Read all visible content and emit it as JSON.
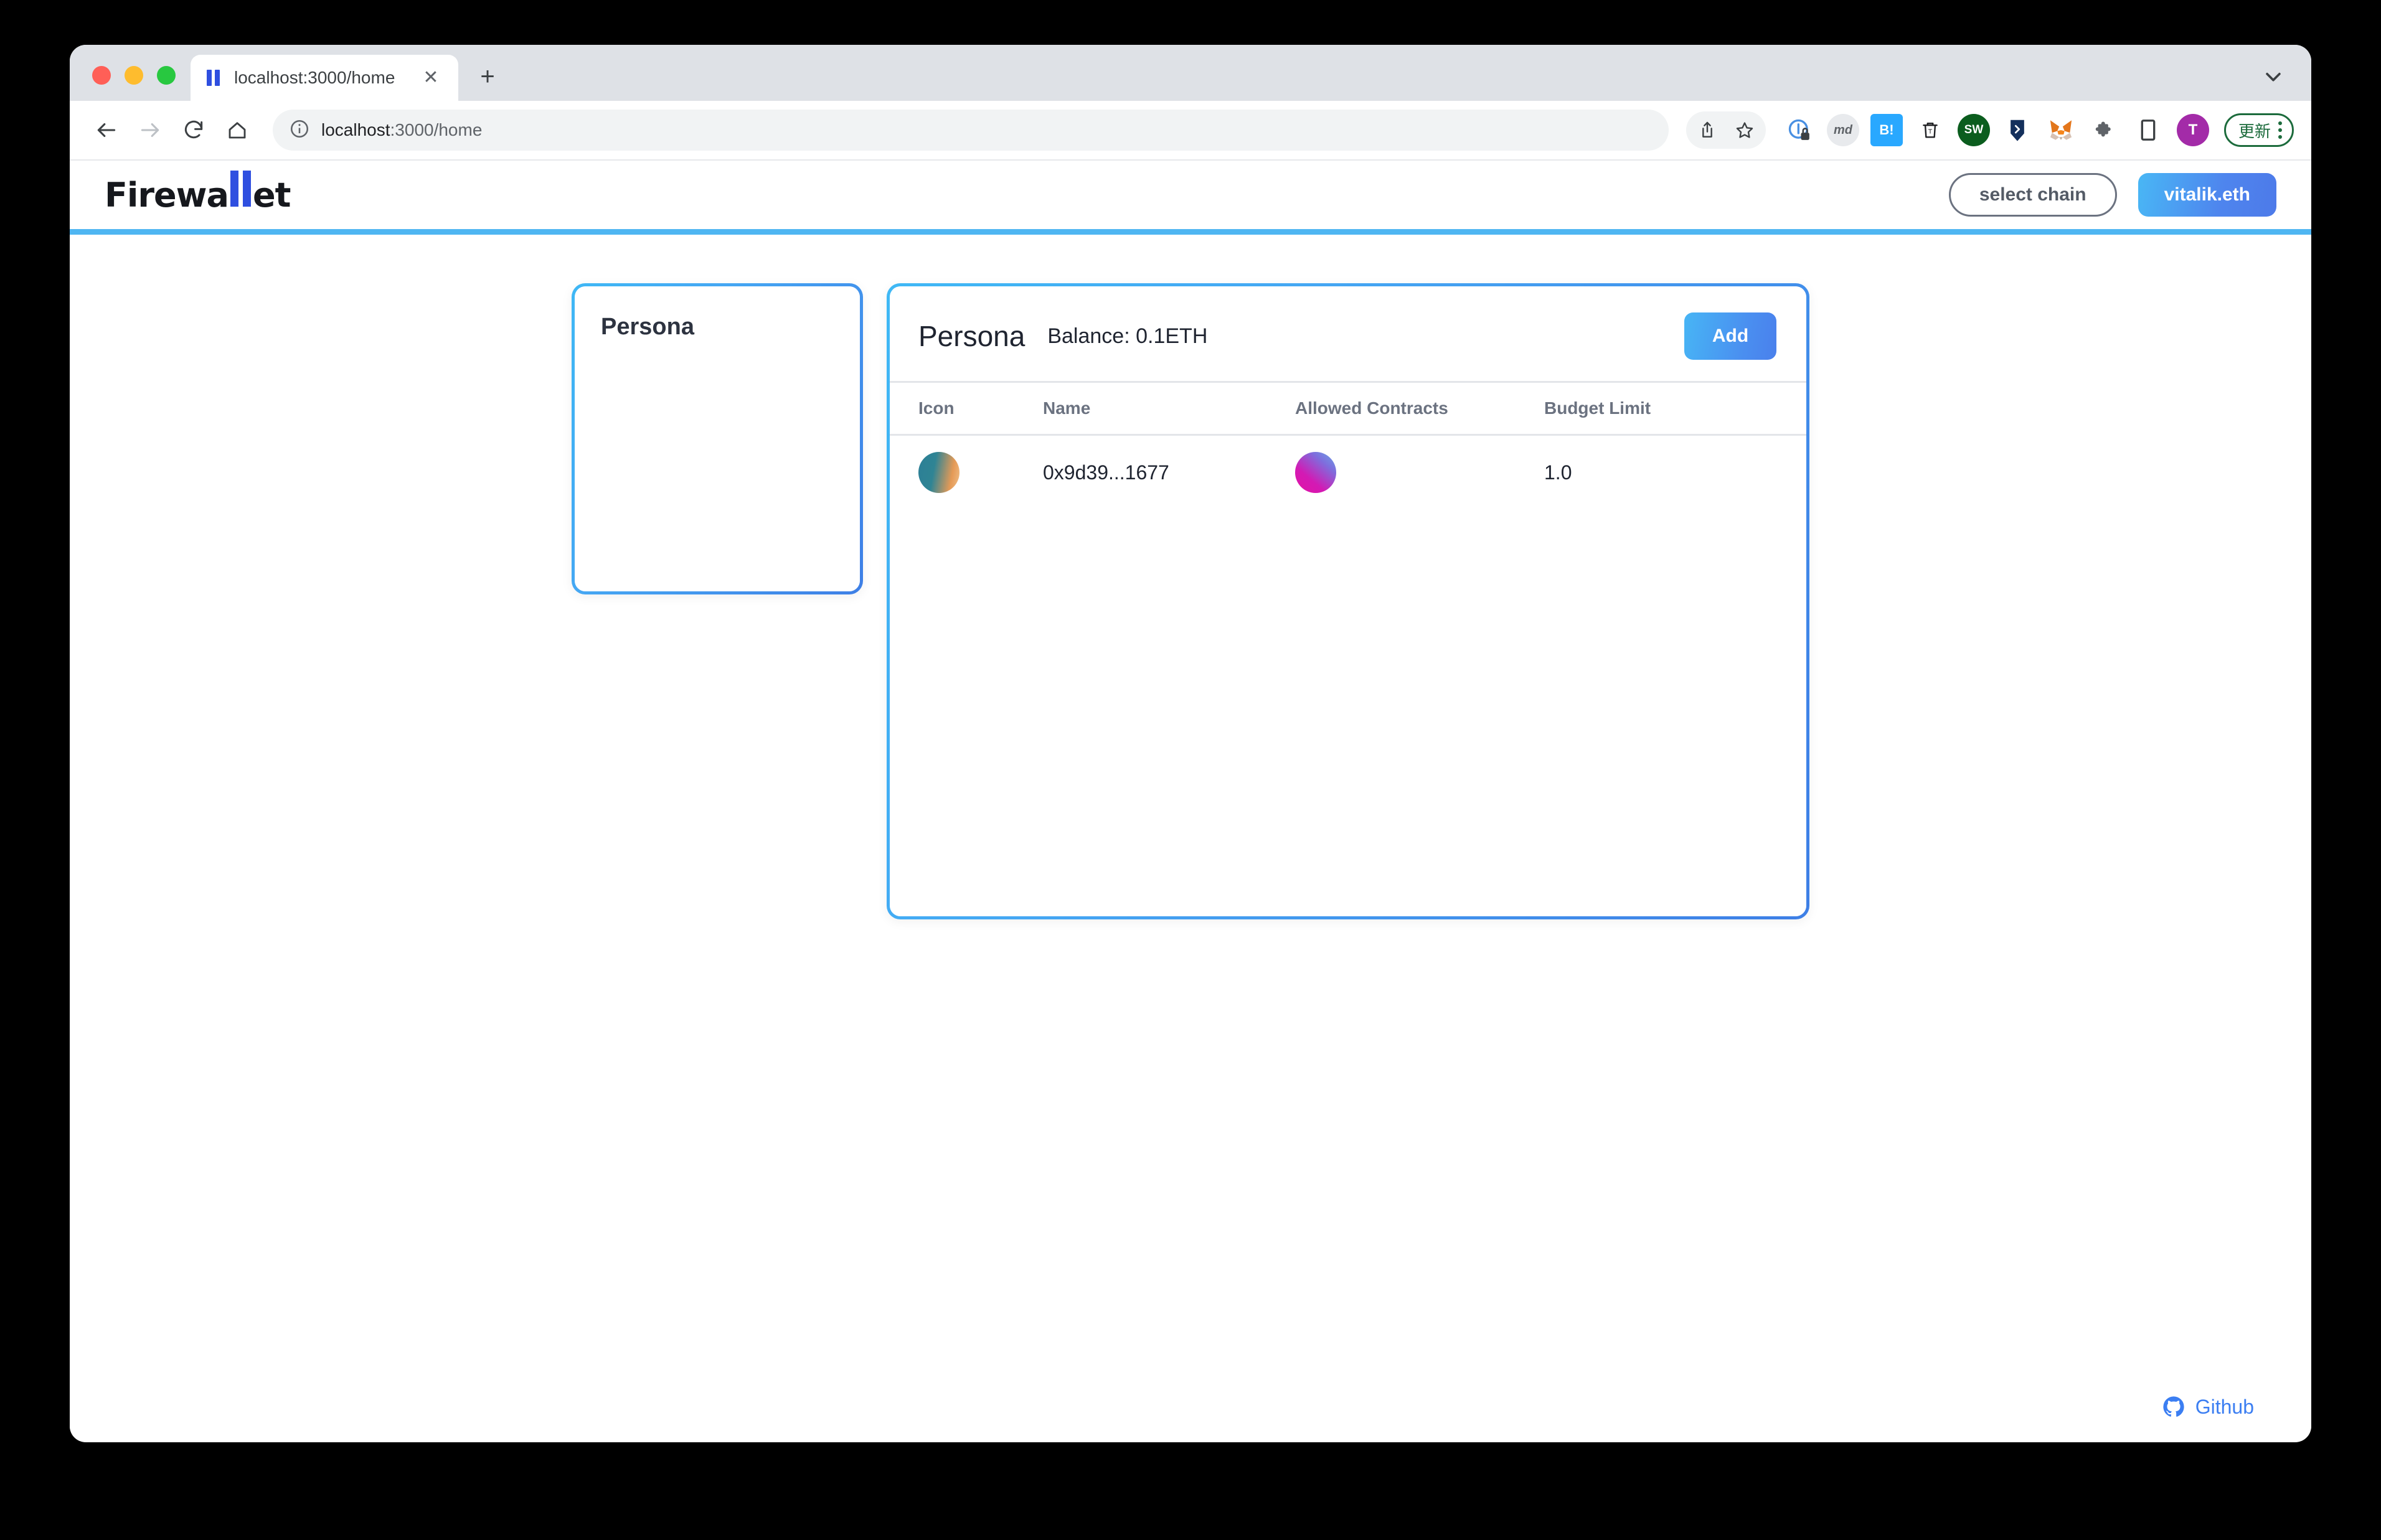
{
  "browser": {
    "tab": {
      "title": "localhost:3000/home",
      "favicon_name": "firewallet-bars-icon",
      "close_label": "✕"
    },
    "new_tab_label": "+",
    "tab_search_name": "chevron-down-icon",
    "nav": {
      "back_label": "←",
      "forward_label": "→",
      "reload_label": "⟳",
      "home_label": "⌂"
    },
    "omnibox": {
      "site_info_label": "ⓘ",
      "url_host": "localhost",
      "url_path": ":3000/home",
      "full_url": "localhost:3000/home"
    },
    "actions": {
      "share_label": "⇧",
      "bookmark_label": "☆",
      "extensions": [
        {
          "name": "privacy-badger-icon",
          "label": "ⓘ"
        },
        {
          "name": "markdown-extension-icon",
          "label": "md"
        },
        {
          "name": "hatena-bookmark-icon",
          "label": "B!"
        },
        {
          "name": "trash-extension-icon",
          "label": "ᴛ"
        },
        {
          "name": "sw-extension-icon",
          "label": "SW"
        },
        {
          "name": "chevron-extension-icon",
          "label": "›"
        },
        {
          "name": "metamask-fox-icon",
          "label": "🦊"
        },
        {
          "name": "puzzle-extensions-icon",
          "label": "❖"
        },
        {
          "name": "device-toolbar-icon",
          "label": "▯"
        }
      ],
      "profile_initial": "T",
      "update_label": "更新",
      "menu_name": "three-dots-menu-icon"
    }
  },
  "app": {
    "logo": {
      "text_start": "Firewa",
      "text_end": "et",
      "bars_name": "logo-blue-bars"
    },
    "select_chain_label": "select chain",
    "account_label": "vitalik.eth",
    "accent_blue": "#4fb6f2",
    "gradient_from": "#3fb8f5",
    "gradient_to": "#3e7fe6"
  },
  "persona_list": {
    "title": "Persona",
    "items": []
  },
  "persona_detail": {
    "title": "Persona",
    "balance": "Balance: 0.1ETH",
    "add_label": "Add",
    "columns": [
      "Icon",
      "Name",
      "Allowed Contracts",
      "Budget Limit"
    ],
    "rows": [
      {
        "icon_name": "persona-avatar",
        "name": "0x9d39...1677",
        "allowed_contract_icon_name": "contract-avatar",
        "budget_limit": "1.0"
      }
    ]
  },
  "footer": {
    "github_label": "Github",
    "github_icon_name": "github-icon"
  }
}
